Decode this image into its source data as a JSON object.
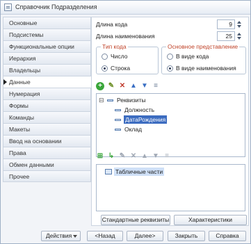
{
  "window": {
    "title": "Справочник Подразделения"
  },
  "nav": {
    "items": [
      {
        "label": "Основные"
      },
      {
        "label": "Подсистемы"
      },
      {
        "label": "Функциональные опции"
      },
      {
        "label": "Иерархия"
      },
      {
        "label": "Владельцы"
      },
      {
        "label": "Данные"
      },
      {
        "label": "Нумерация"
      },
      {
        "label": "Формы"
      },
      {
        "label": "Команды"
      },
      {
        "label": "Макеты"
      },
      {
        "label": "Ввод на основании"
      },
      {
        "label": "Права"
      },
      {
        "label": "Обмен данными"
      },
      {
        "label": "Прочее"
      }
    ],
    "active": "Данные"
  },
  "data_tab": {
    "code_length_label": "Длина кода",
    "code_length_value": "9",
    "name_length_label": "Длина наименования",
    "name_length_value": "25",
    "code_type": {
      "title": "Тип кода",
      "options": [
        {
          "label": "Число",
          "checked": false
        },
        {
          "label": "Строка",
          "checked": true
        }
      ]
    },
    "main_representation": {
      "title": "Основное представление",
      "options": [
        {
          "label": "В виде кода",
          "checked": false
        },
        {
          "label": "В виде наименования",
          "checked": true
        }
      ]
    },
    "requisites_tree": {
      "root": "Реквизиты",
      "children": [
        {
          "label": "Должность",
          "selected": false
        },
        {
          "label": "ДатаРождения",
          "selected": true
        },
        {
          "label": "Оклад",
          "selected": false
        }
      ]
    },
    "tabular_tree": {
      "root": "Табличные части"
    },
    "standard_requisites_button": "Стандартные реквизиты",
    "characteristics_button": "Характеристики"
  },
  "footer": {
    "actions_label": "Действия",
    "back_label": "<Назад",
    "next_label": "Далее>",
    "close_label": "Закрыть",
    "help_label": "Справка"
  }
}
